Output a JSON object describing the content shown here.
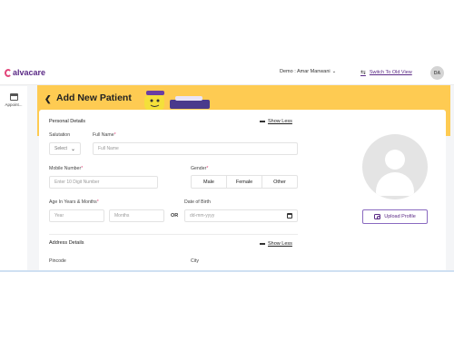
{
  "brand": {
    "name": "alvacare"
  },
  "header": {
    "user_label": "Demo : Amar Manwani",
    "switch_label": "Switch To Old View",
    "avatar_initials": "DA"
  },
  "rail": {
    "items": [
      {
        "label": "Appoint...",
        "icon": "calendar-icon"
      }
    ]
  },
  "page": {
    "back_icon": "chevron-left",
    "title": "Add New Patient"
  },
  "personal": {
    "section_title": "Personal Details",
    "toggle_label": "Show Less",
    "salutation": {
      "label": "Salutation",
      "value": "Select"
    },
    "full_name": {
      "label": "Full Name",
      "placeholder": "Full Name"
    },
    "mobile": {
      "label": "Mobile Number",
      "placeholder": "Enter 10 Digit Number"
    },
    "gender": {
      "label": "Gender",
      "options": [
        "Male",
        "Female",
        "Other"
      ]
    },
    "age": {
      "label": "Age In Years & Months",
      "year_placeholder": "Year",
      "months_placeholder": "Months",
      "or_label": "OR"
    },
    "dob": {
      "label": "Date of Birth",
      "placeholder": "dd-mm-yyyy"
    },
    "required_mark": "*"
  },
  "address": {
    "section_title": "Address Details",
    "toggle_label": "Show Less",
    "pincode_label": "Pincode",
    "city_label": "City"
  },
  "profile": {
    "upload_label": "Upload Profile"
  },
  "colors": {
    "banner": "#fecb52",
    "brand": "#5b2a86",
    "required": "#e2457a"
  }
}
